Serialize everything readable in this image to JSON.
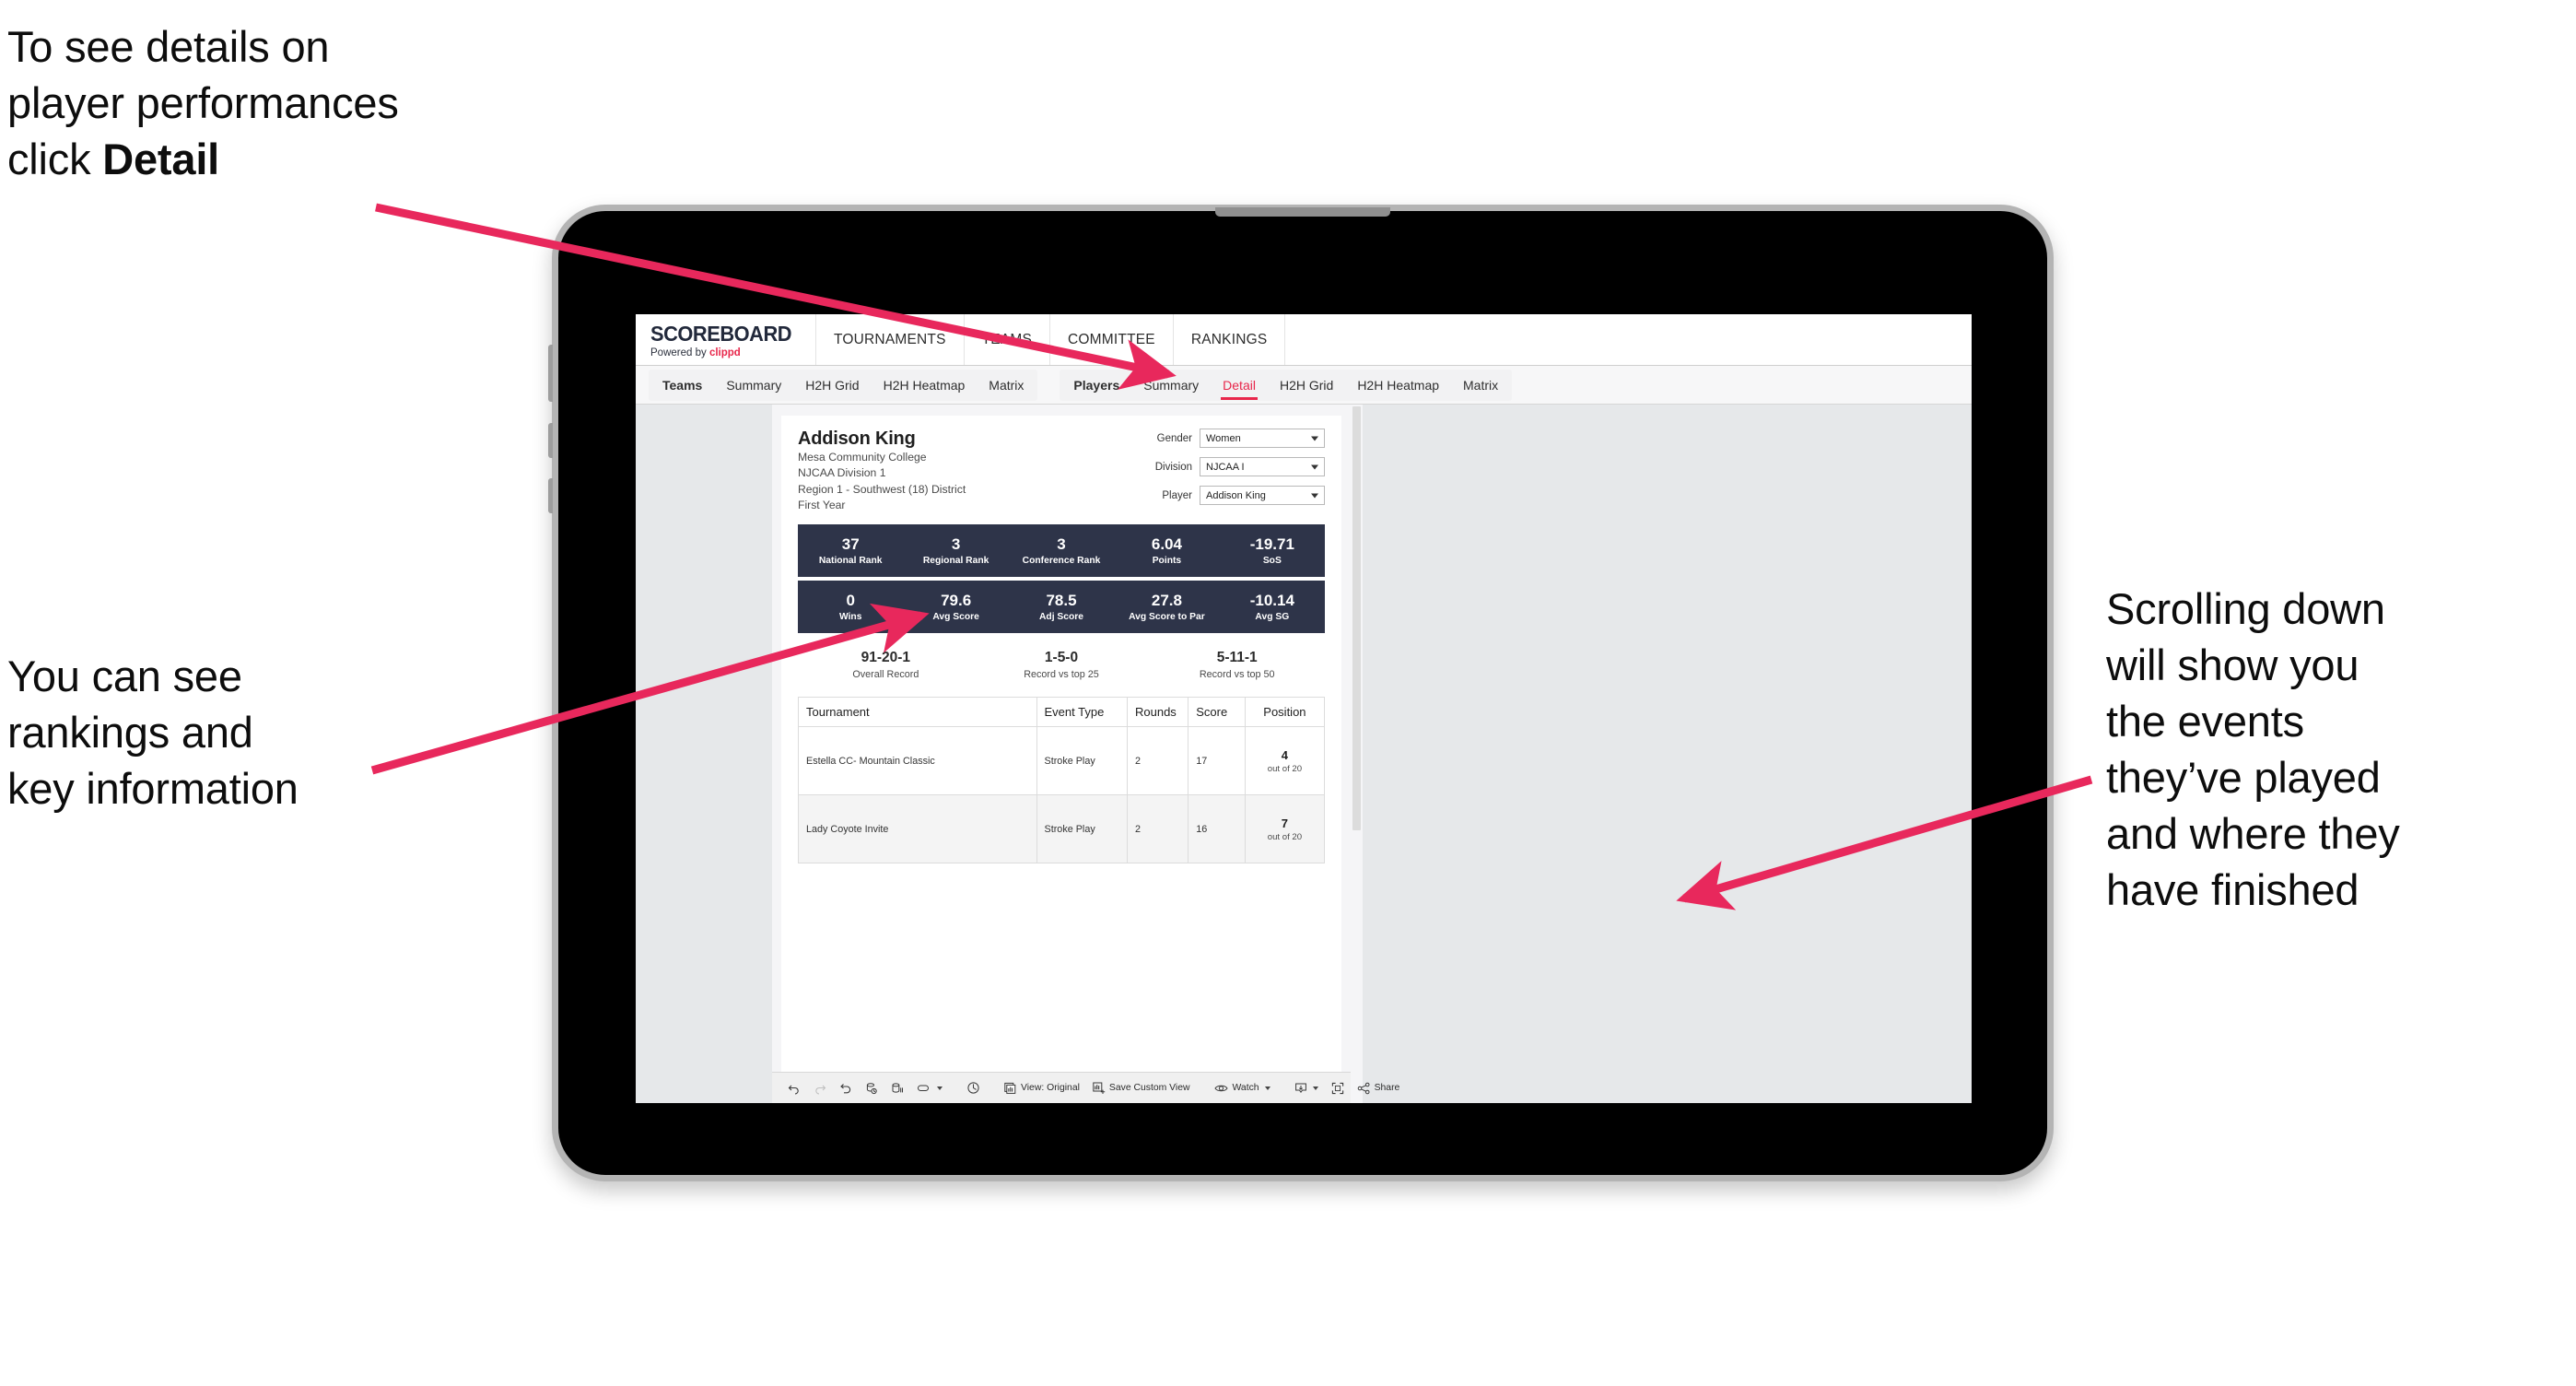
{
  "annotations": {
    "top_left": {
      "line1": "To see details on",
      "line2": "player performances",
      "line3_prefix": "click ",
      "line3_bold": "Detail"
    },
    "mid_left": {
      "line1": "You can see",
      "line2": "rankings and",
      "line3": "key information"
    },
    "right": {
      "line1": "Scrolling down",
      "line2": "will show you",
      "line3": "the events",
      "line4": "they’ve played",
      "line5": "and where they",
      "line6": "have finished"
    },
    "arrow_color": "#e8285c"
  },
  "app": {
    "logo": {
      "title": "SCOREBOARD",
      "powered_prefix": "Powered by ",
      "powered_brand": "clippd"
    },
    "top_nav": [
      "TOURNAMENTS",
      "TEAMS",
      "COMMITTEE",
      "RANKINGS"
    ],
    "sub_nav": {
      "group_teams": [
        "Teams",
        "Summary",
        "H2H Grid",
        "H2H Heatmap",
        "Matrix"
      ],
      "group_players": [
        "Players",
        "Summary",
        "Detail",
        "H2H Grid",
        "H2H Heatmap",
        "Matrix"
      ],
      "active_tab": "Detail"
    },
    "accent_color": "#e8274b",
    "stat_bar_color": "#2e3449"
  },
  "player": {
    "name": "Addison King",
    "school": "Mesa Community College",
    "division": "NJCAA Division 1",
    "region": "Region 1 - Southwest (18) District",
    "year": "First Year"
  },
  "filters": [
    {
      "label": "Gender",
      "value": "Women"
    },
    {
      "label": "Division",
      "value": "NJCAA I"
    },
    {
      "label": "Player",
      "value": "Addison King"
    }
  ],
  "stats_row_1": [
    {
      "value": "37",
      "label": "National Rank"
    },
    {
      "value": "3",
      "label": "Regional Rank"
    },
    {
      "value": "3",
      "label": "Conference Rank"
    },
    {
      "value": "6.04",
      "label": "Points"
    },
    {
      "value": "-19.71",
      "label": "SoS"
    }
  ],
  "stats_row_2": [
    {
      "value": "0",
      "label": "Wins"
    },
    {
      "value": "79.6",
      "label": "Avg Score"
    },
    {
      "value": "78.5",
      "label": "Adj Score"
    },
    {
      "value": "27.8",
      "label": "Avg Score to Par"
    },
    {
      "value": "-10.14",
      "label": "Avg SG"
    }
  ],
  "records": [
    {
      "value": "91-20-1",
      "label": "Overall Record"
    },
    {
      "value": "1-5-0",
      "label": "Record vs top 25"
    },
    {
      "value": "5-11-1",
      "label": "Record vs top 50"
    }
  ],
  "tournament_table": {
    "headers": [
      "Tournament",
      "Event Type",
      "Rounds",
      "Score",
      "Position"
    ],
    "rows": [
      {
        "tournament": "Estella CC- Mountain Classic",
        "event_type": "Stroke Play",
        "rounds": "2",
        "score": "17",
        "position": "4",
        "out_of": "out of 20"
      },
      {
        "tournament": "Lady Coyote Invite",
        "event_type": "Stroke Play",
        "rounds": "2",
        "score": "16",
        "position": "7",
        "out_of": "out of 20"
      }
    ]
  },
  "toolbar": {
    "view_label": "View: Original",
    "save_label": "Save Custom View",
    "watch_label": "Watch",
    "share_label": "Share"
  }
}
